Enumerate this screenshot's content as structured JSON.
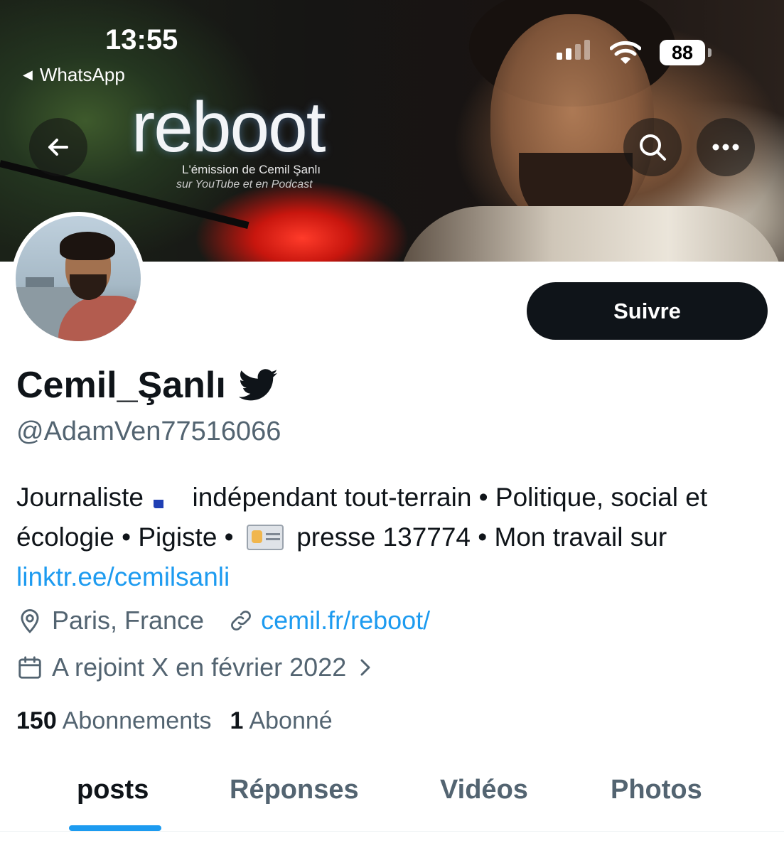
{
  "status_bar": {
    "time": "13:55",
    "back_app": "WhatsApp",
    "battery": "88"
  },
  "banner": {
    "logo": "reboot",
    "subtitle_1": "L'émission de Cemil Şanlı",
    "subtitle_2": "sur YouTube et en Podcast"
  },
  "profile": {
    "display_name": "Cemil_Şanlı",
    "handle": "@AdamVen77516066",
    "bio_part1": "Journaliste",
    "bio_part2": "indépendant tout-terrain • Politique, social et écologie • Pigiste •",
    "bio_part3": "presse 137774 • Mon travail sur",
    "bio_link": "linktr.ee/cemilsanli",
    "location": "Paris, France",
    "website": "cemil.fr/reboot/",
    "joined": "A rejoint X en février 2022",
    "following_count": "150",
    "following_label": "Abonnements",
    "followers_count": "1",
    "followers_label": "Abonné"
  },
  "actions": {
    "follow_label": "Suivre"
  },
  "tabs": [
    {
      "label": "posts",
      "active": true
    },
    {
      "label": "Réponses",
      "active": false
    },
    {
      "label": "Vidéos",
      "active": false
    },
    {
      "label": "Photos",
      "active": false
    }
  ],
  "colors": {
    "accent": "#1d9bf0",
    "text_primary": "#0f1419",
    "text_secondary": "#536471",
    "follow_button": "#0f1419"
  },
  "icons": [
    "arrow-left-icon",
    "search-icon",
    "more-icon",
    "bird-icon",
    "location-pin-icon",
    "link-icon",
    "calendar-icon",
    "chevron-right-icon",
    "france-flag-icon",
    "id-card-icon"
  ]
}
